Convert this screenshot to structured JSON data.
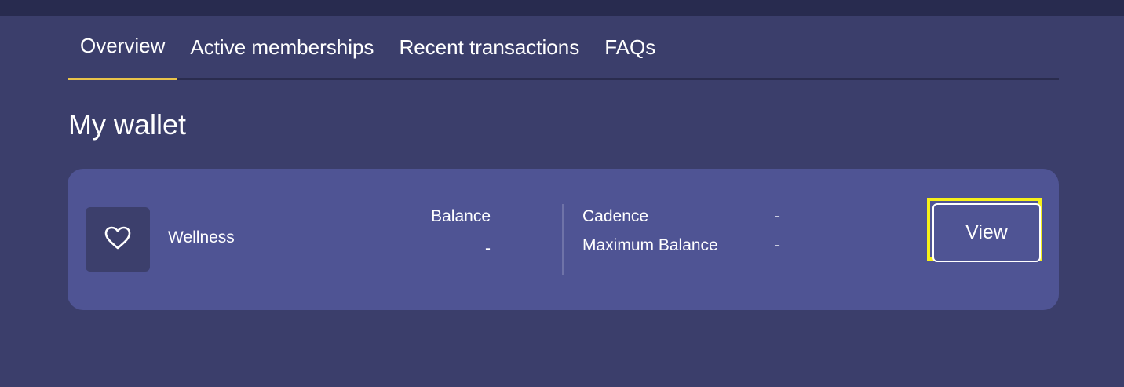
{
  "tabs": [
    {
      "label": "Overview",
      "active": true
    },
    {
      "label": "Active memberships",
      "active": false
    },
    {
      "label": "Recent transactions",
      "active": false
    },
    {
      "label": "FAQs",
      "active": false
    }
  ],
  "page": {
    "title": "My wallet"
  },
  "wallet": {
    "icon": "heart-icon",
    "name": "Wellness",
    "balance_label": "Balance",
    "balance_value": "-",
    "cadence_label": "Cadence",
    "cadence_value": "-",
    "max_balance_label": "Maximum Balance",
    "max_balance_value": "-",
    "view_label": "View"
  },
  "colors": {
    "background": "#3b3e6b",
    "top_bar": "#282b4f",
    "card": "#4f5494",
    "active_tab_underline": "#e9c34a",
    "highlight": "#f6f01a"
  }
}
